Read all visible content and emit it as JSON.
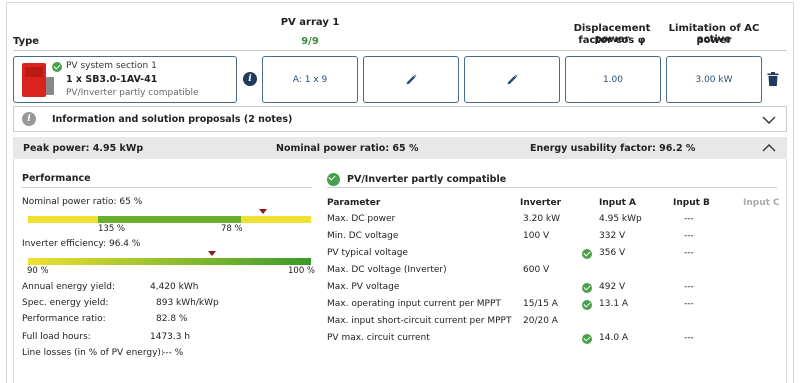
{
  "header": {
    "type_label": "Type",
    "pv_array_title": "PV array 1",
    "pv_array_count": "9/9",
    "displacement_label_1": "Displacement power",
    "displacement_label_2": "factor cos φ",
    "limitation_label_1": "Limitation of AC active",
    "limitation_label_2": "power"
  },
  "product": {
    "section_name": "PV system section 1",
    "model": "1 x SB3.0-1AV-41",
    "status": "PV/Inverter partly compatible"
  },
  "cells": {
    "array_config": "A: 1 x 9",
    "cos_phi": "1.00",
    "ac_limit": "3.00 kW"
  },
  "info_panel": {
    "label": "Information and solution proposals (2 notes)"
  },
  "summary": {
    "peak_power": "Peak power: 4.95 kWp",
    "nominal_ratio": "Nominal power ratio: 65 %",
    "energy_usability": "Energy usability factor: 96.2 %"
  },
  "performance": {
    "title": "Performance",
    "nominal_label": "Nominal power ratio: 65 %",
    "nominal_marker_fraction": 0.83,
    "nominal_tick_left": "135 %",
    "nominal_tick_right": "78 %",
    "efficiency_label": "Inverter efficiency: 96.4 %",
    "efficiency_marker_fraction": 0.65,
    "efficiency_tick_left": "90 %",
    "efficiency_tick_right": "100 %",
    "rows": [
      {
        "label": "Annual energy yield:",
        "value": "4,420 kWh"
      },
      {
        "label": "Spec. energy yield:",
        "value": "893 kWh/kWp"
      },
      {
        "label": "Performance ratio:",
        "value": "82.8 %"
      },
      {
        "label": "Full load hours:",
        "value": "1473.3  h"
      },
      {
        "label": "Line losses (in % of PV energy):",
        "value": "--- %"
      }
    ]
  },
  "compat": {
    "title": "PV/Inverter partly compatible",
    "columns": [
      "Parameter",
      "Inverter",
      "Input A",
      "Input B",
      "Input C"
    ],
    "rows": [
      {
        "param": "Max. DC power",
        "inverter": "3.20 kW",
        "check": false,
        "a": "4.95 kWp",
        "b": "---"
      },
      {
        "param": "Min. DC voltage",
        "inverter": "100 V",
        "check": false,
        "a": "332 V",
        "b": "---"
      },
      {
        "param": "PV typical voltage",
        "inverter": "",
        "check": true,
        "a": "356 V",
        "b": "---"
      },
      {
        "param": "Max. DC voltage (Inverter)",
        "inverter": "600 V",
        "check": false,
        "a": "",
        "b": ""
      },
      {
        "param": "Max. PV voltage",
        "inverter": "",
        "check": true,
        "a": "492 V",
        "b": "---"
      },
      {
        "param": "Max. operating input current per MPPT",
        "inverter": "15/15 A",
        "check": true,
        "a": "13.1 A",
        "b": "---"
      },
      {
        "param": "Max. input short-circuit current per MPPT",
        "inverter": "20/20 A",
        "check": false,
        "a": "",
        "b": ""
      },
      {
        "param": "PV max. circuit current",
        "inverter": "",
        "check": true,
        "a": "14.0 A",
        "b": "---"
      }
    ]
  }
}
